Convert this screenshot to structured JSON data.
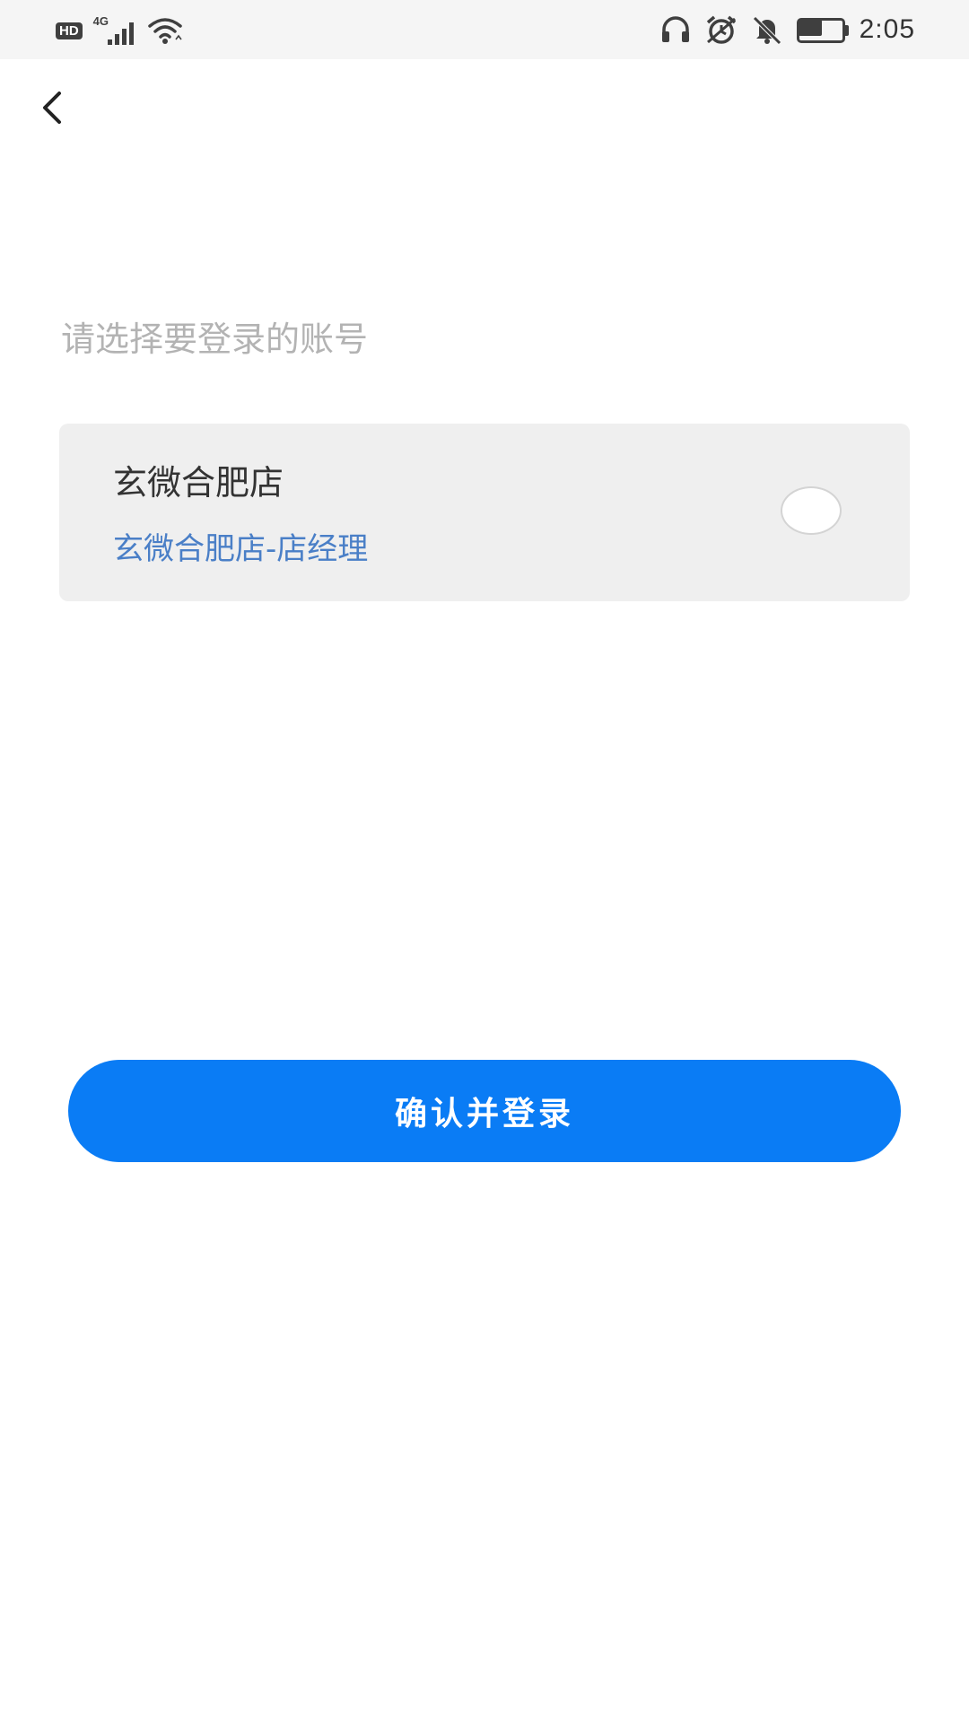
{
  "status_bar": {
    "hd_label": "HD",
    "network_label": "4G",
    "time": "2:05",
    "battery_level": 0.55,
    "icons": [
      "signal-icon",
      "wifi-icon",
      "headphones-icon",
      "alarm-icon",
      "mute-icon",
      "battery-icon"
    ]
  },
  "header": {
    "back_icon": "chevron-left-icon"
  },
  "main": {
    "prompt": "请选择要登录的账号",
    "accounts": [
      {
        "name": "玄微合肥店",
        "role": "玄微合肥店-店经理",
        "selected": false
      }
    ],
    "confirm_label": "确认并登录"
  },
  "colors": {
    "accent": "#0a7cf5",
    "role_text": "#4a7fc7",
    "card_bg": "#efefef",
    "prompt_text": "#b3b3b3"
  }
}
